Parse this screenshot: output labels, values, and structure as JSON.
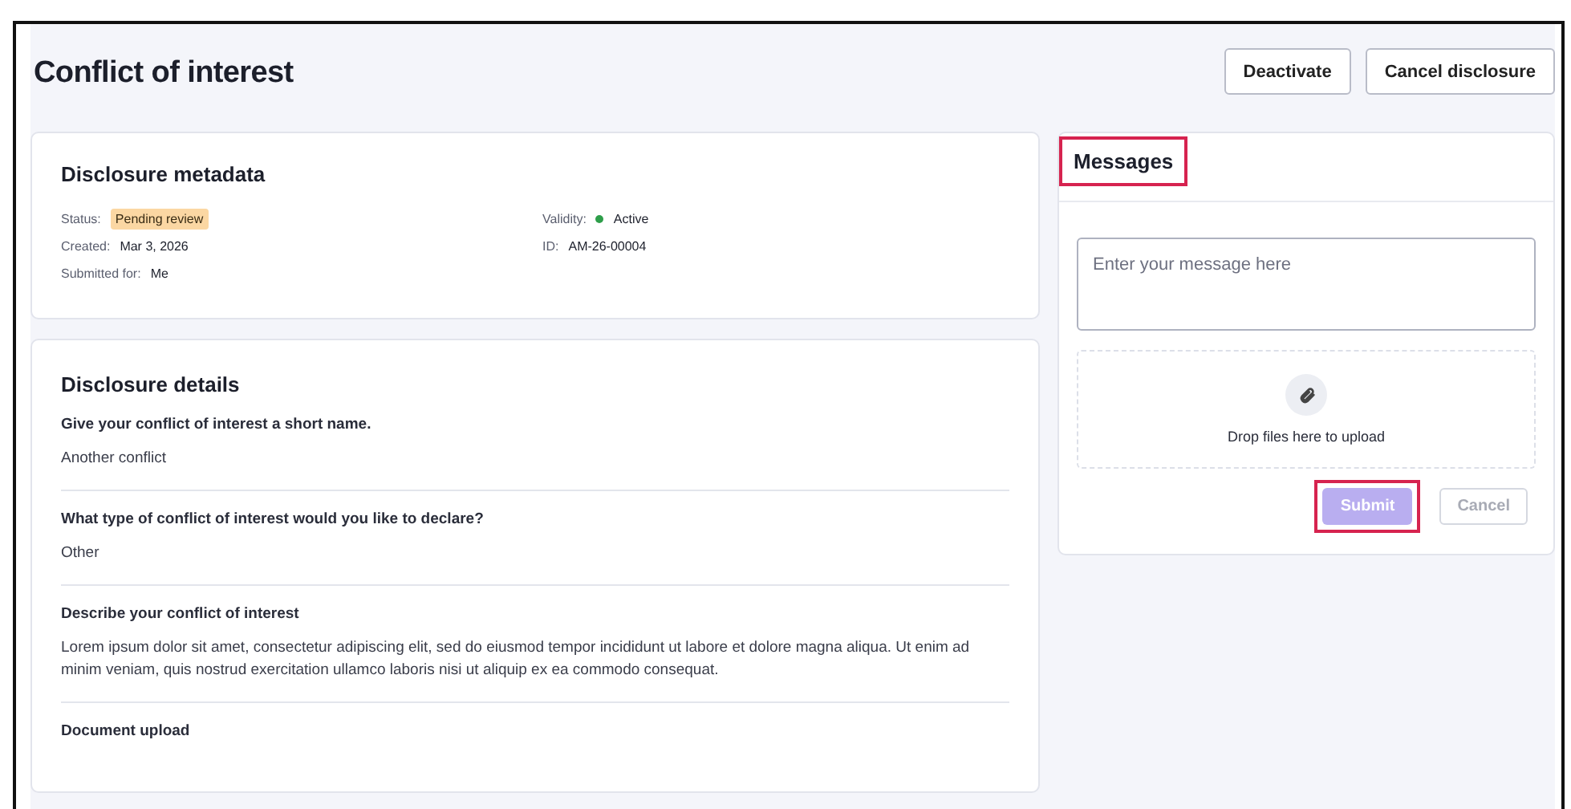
{
  "page": {
    "title": "Conflict of interest",
    "actions": [
      {
        "label": "Deactivate"
      },
      {
        "label": "Cancel disclosure"
      }
    ]
  },
  "metadata": {
    "title": "Disclosure metadata",
    "fields": [
      {
        "label": "Status:",
        "value": "Pending review",
        "kind": "badge"
      },
      {
        "label": "Validity:",
        "value": "Active",
        "kind": "dot",
        "color": "#2e9e4a"
      },
      {
        "label": "Created:",
        "value": "Mar 3, 2026",
        "kind": "text"
      },
      {
        "label": "ID:",
        "value": "AM-26-00004",
        "kind": "text"
      },
      {
        "label": "Submitted for:",
        "value": "Me",
        "kind": "text"
      }
    ]
  },
  "details": {
    "title": "Disclosure details",
    "questions": [
      {
        "question": "Give your conflict of interest a short name.",
        "answer": "Another conflict"
      },
      {
        "question": "What type of conflict of interest would you like to declare?",
        "answer": "Other"
      },
      {
        "question": "Describe your conflict of interest",
        "answer": "Lorem ipsum dolor sit amet, consectetur adipiscing elit, sed do eiusmod tempor incididunt ut labore et dolore magna aliqua. Ut enim ad minim veniam, quis nostrud exercitation ullamco laboris nisi ut aliquip ex ea commodo consequat."
      },
      {
        "question": "Document upload"
      }
    ]
  },
  "messages": {
    "title": "Messages",
    "title_highlighted": true,
    "placeholder": "Enter your message here",
    "dropzone": "Drop files here to upload",
    "buttons": [
      {
        "label": "Submit",
        "kind": "primary",
        "disabled": true,
        "highlighted": true
      },
      {
        "label": "Cancel",
        "kind": "secondary",
        "disabled": true,
        "highlighted": false
      }
    ]
  }
}
